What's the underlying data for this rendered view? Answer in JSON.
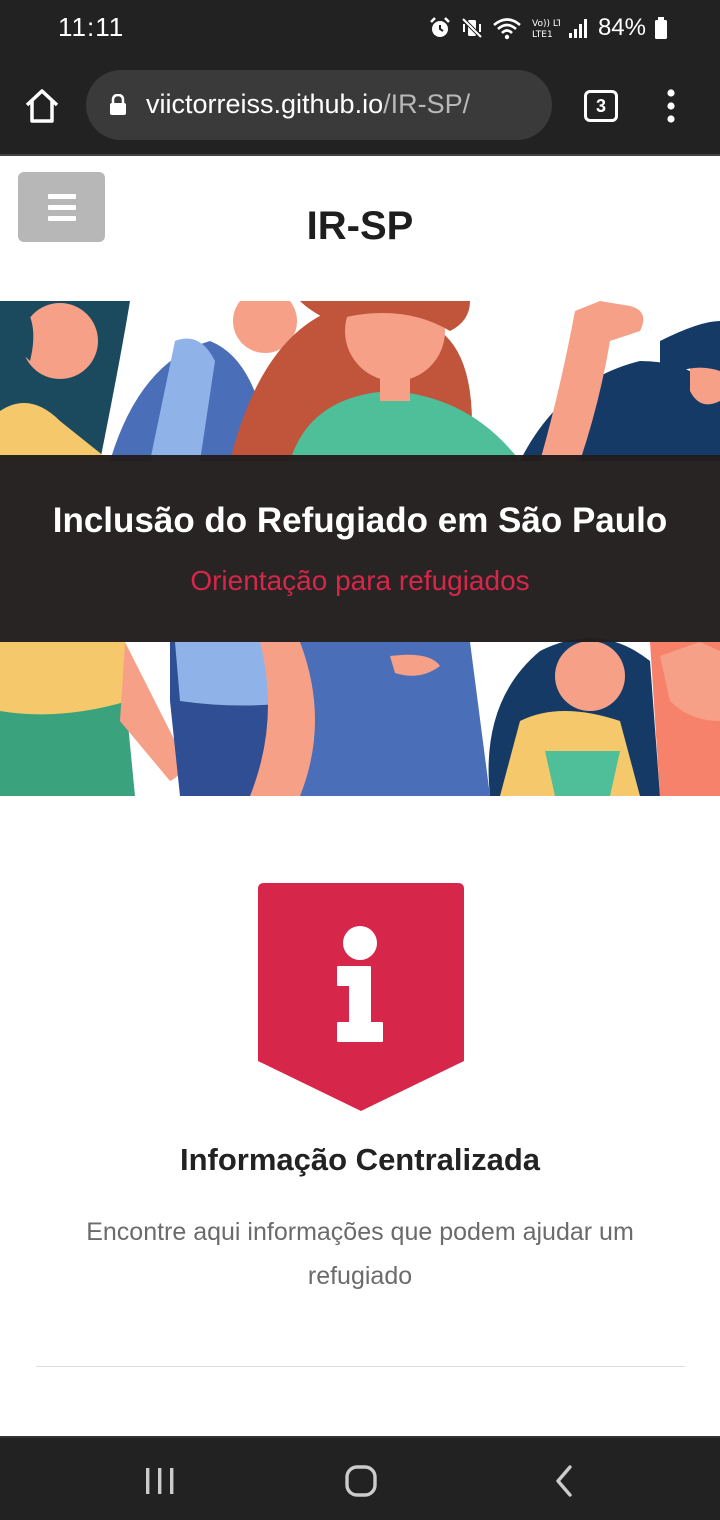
{
  "status_bar": {
    "time": "11:11",
    "battery_percent": "84%",
    "network_label": "Vo)) LTE1",
    "icons": [
      "alarm-icon",
      "vibrate-mute-icon",
      "wifi-icon",
      "volte-lte-icon",
      "signal-icon",
      "battery-icon"
    ]
  },
  "browser": {
    "url_domain": "viictorreiss.github.io",
    "url_path": "/IR-SP/",
    "tab_count": "3",
    "icons": [
      "home-icon",
      "lock-icon",
      "tabs-icon",
      "more-vert-icon"
    ]
  },
  "header": {
    "site_title": "IR-SP",
    "menu_icon": "hamburger-icon"
  },
  "hero": {
    "title": "Inclusão do Refugiado em São Paulo",
    "subtitle": "Orientação para refugiados"
  },
  "feature": {
    "icon": "info-icon",
    "title": "Informação Centralizada",
    "description": "Encontre aqui informações que podem ajudar um refugiado"
  },
  "nav_bar": {
    "icons": [
      "recent-apps-icon",
      "home-circle-icon",
      "back-icon"
    ]
  },
  "colors": {
    "accent": "#d6264a",
    "dark": "#222222",
    "overlay": "#221d1d"
  }
}
